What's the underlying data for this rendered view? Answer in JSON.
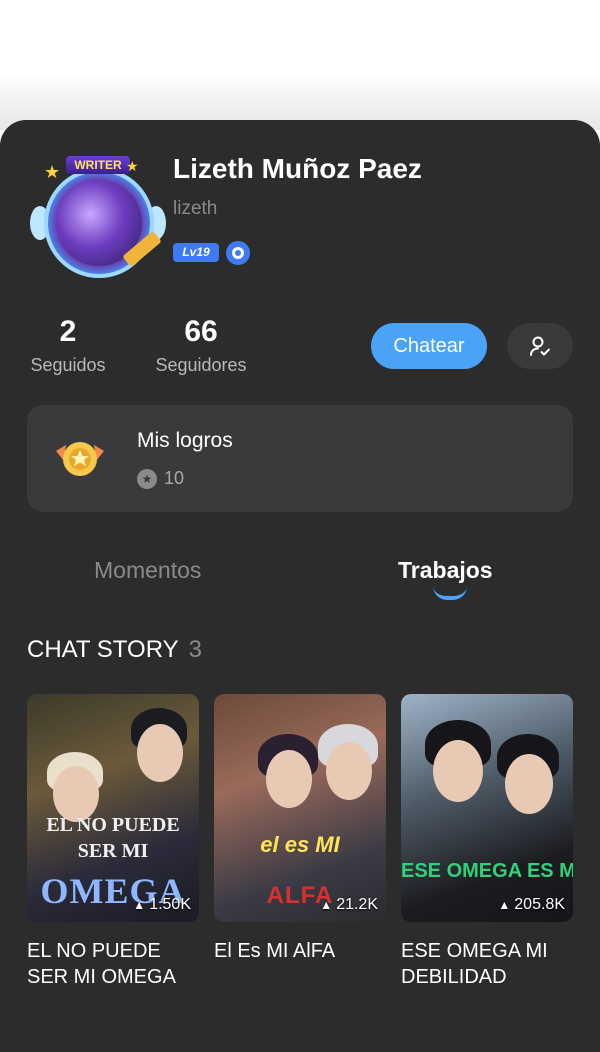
{
  "profile": {
    "name": "Lizeth Muñoz Paez",
    "username": "lizeth",
    "level": "Lv19",
    "avatar_frame_text": "WRITER"
  },
  "stats": [
    {
      "value": "2",
      "label": "Seguidos"
    },
    {
      "value": "66",
      "label": "Seguidores"
    }
  ],
  "actions": {
    "chat_label": "Chatear",
    "follow_icon": "user-check-icon"
  },
  "achievements": {
    "title": "Mis logros",
    "count": "10"
  },
  "tabs": [
    {
      "label": "Momentos",
      "active": false
    },
    {
      "label": "Trabajos",
      "active": true
    }
  ],
  "section": {
    "title": "CHAT STORY",
    "count": "3"
  },
  "stories": [
    {
      "cover_line1": "EL NO PUEDE SER MI",
      "cover_line2": "OMEGA",
      "views": "1.50K",
      "title": "EL NO PUEDE SER MI OMEGA"
    },
    {
      "cover_line1": "el es MI",
      "cover_line2": "ALFA",
      "views": "21.2K",
      "title": "El Es MI AlFA"
    },
    {
      "cover_line1": "ESE OMEGA ES MI DEBILIDAD",
      "cover_line2": "",
      "views": "205.8K",
      "title": "ESE OMEGA MI DEBILIDAD"
    }
  ],
  "colors": {
    "panel_bg": "#2c2c2d",
    "card_bg": "#3a3a3c",
    "accent": "#4aa3f7",
    "level_badge": "#3e7bf2"
  }
}
